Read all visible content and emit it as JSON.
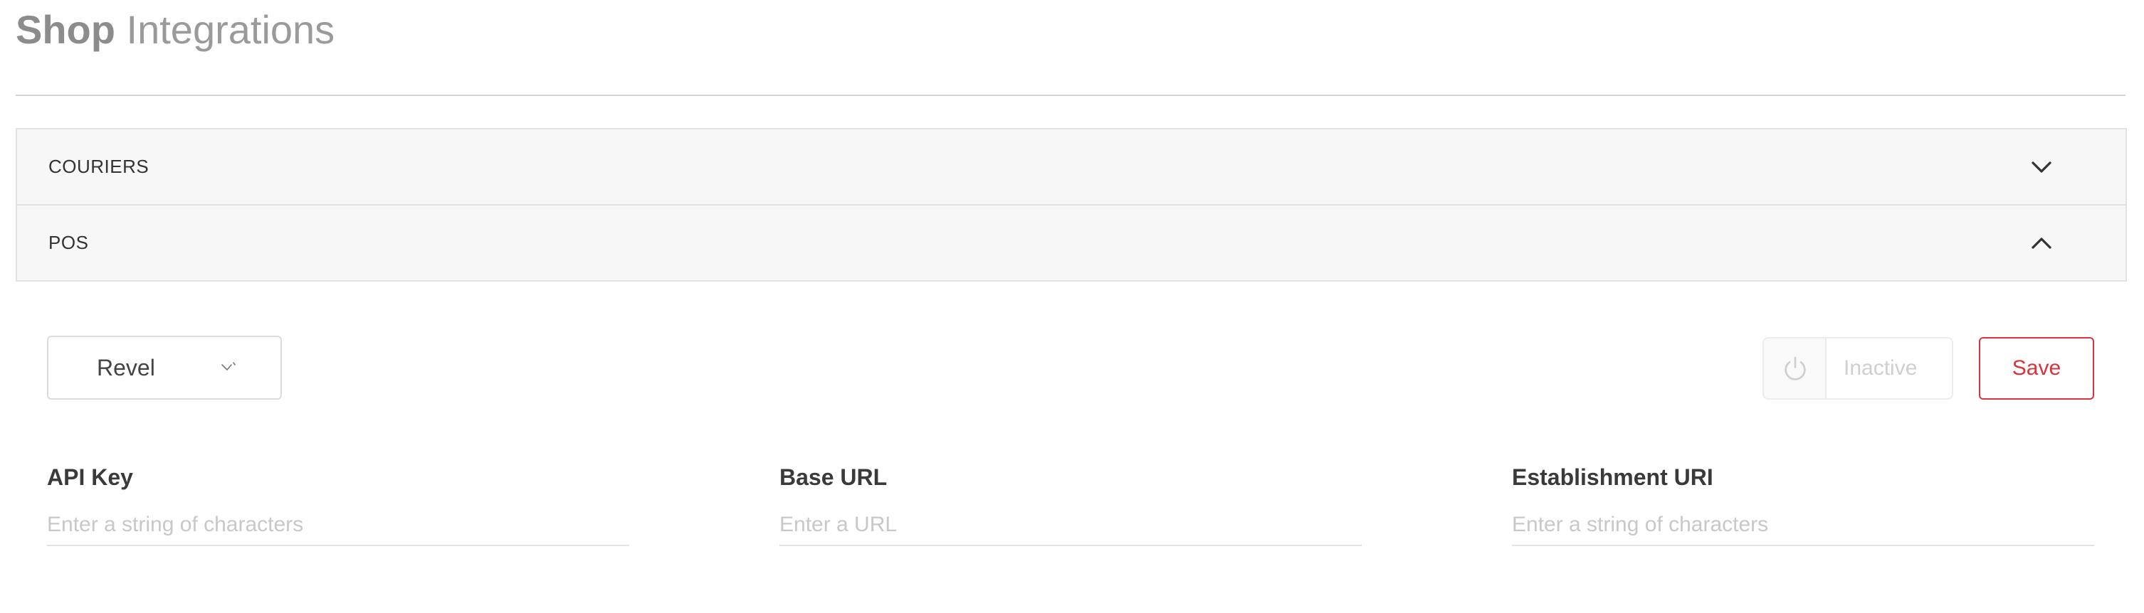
{
  "header": {
    "title_strong": "Shop",
    "title_light": "Integrations"
  },
  "accordion": {
    "sections": [
      {
        "label": "COURIERS",
        "state": "collapsed",
        "icon": "chevron-down-icon"
      },
      {
        "label": "POS",
        "state": "expanded",
        "icon": "chevron-up-icon"
      }
    ]
  },
  "pos": {
    "provider_select": {
      "value": "Revel",
      "icon": "chevron-down-icon"
    },
    "status_toggle": {
      "label": "Inactive",
      "icon": "power-icon",
      "active": false
    },
    "save_label": "Save",
    "fields": [
      {
        "label": "API Key",
        "placeholder": "Enter a string of characters",
        "value": ""
      },
      {
        "label": "Base URL",
        "placeholder": "Enter a URL",
        "value": ""
      },
      {
        "label": "Establishment URI",
        "placeholder": "Enter a string of characters",
        "value": ""
      }
    ]
  },
  "colors": {
    "accent": "#d9343d",
    "panel_bg": "#f7f7f7",
    "border": "#e2e2e2",
    "muted_text": "#c8c8c8"
  }
}
